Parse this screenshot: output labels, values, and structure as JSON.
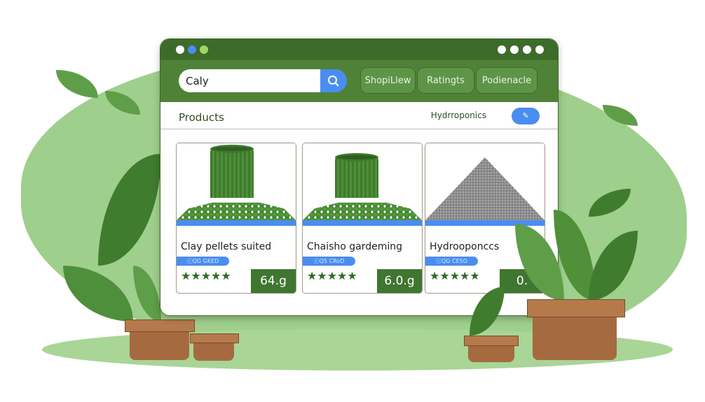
{
  "window": {
    "left_dots": [
      "#ffffff",
      "#4a8df0",
      "#9fd66b"
    ],
    "right_dots": 4
  },
  "toolbar": {
    "search_value": "Caly",
    "search_icon": "search-icon",
    "tabs": [
      "ShopiLlew",
      "Ratingts",
      "Podienacle"
    ]
  },
  "products": {
    "title": "Products",
    "filter_label": "Hydrroponics",
    "toggle_icon": "pencil-icon"
  },
  "cards": [
    {
      "name": "Clay pellets suited",
      "badge": "ⓒQG GKED",
      "rating": 5,
      "stars": "★★★★★",
      "price": "64.g",
      "image": "green-cylinder-pellets"
    },
    {
      "name": "Chaisho  gardeming",
      "badge": "ⓒQS CRoD",
      "rating": 5,
      "stars": "★★★★★",
      "price": "6.0.g",
      "image": "green-cylinder-pellets"
    },
    {
      "name": "Hydrooponccs",
      "badge": "ⓒQG CESO",
      "rating": 5,
      "stars": "★★★★★",
      "price": "0.",
      "image": "grey-gravel-pile"
    }
  ],
  "colors": {
    "accent": "#4a8df0",
    "brand_green": "#4f8237",
    "dark_green": "#3d6b29"
  }
}
